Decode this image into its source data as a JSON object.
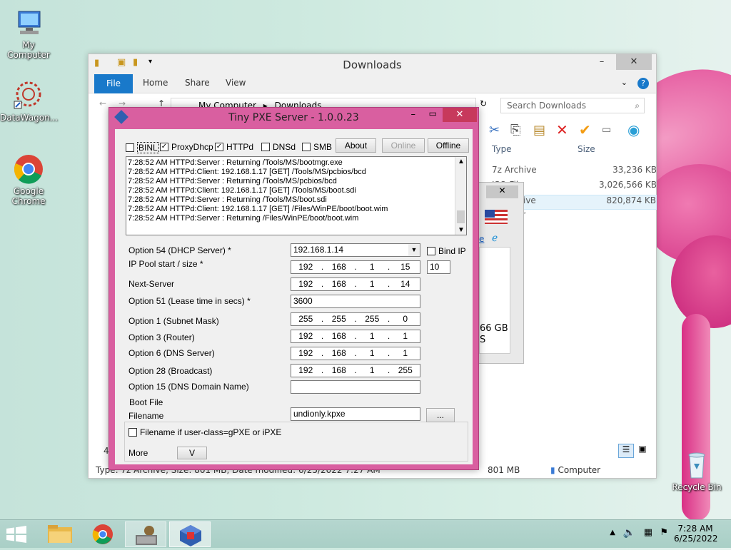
{
  "desktop": {
    "icons": [
      {
        "label": "My Computer"
      },
      {
        "label": "DataWagon..."
      },
      {
        "label": "Google Chrome"
      },
      {
        "label": "Recycle Bin"
      }
    ]
  },
  "explorer": {
    "title": "Downloads",
    "tabs": {
      "file": "File",
      "home": "Home",
      "share": "Share",
      "view": "View"
    },
    "breadcrumb": {
      "root": "My Computer",
      "sep": "▸",
      "current": "Downloads"
    },
    "search_placeholder": "Search Downloads",
    "columns": {
      "type": "Type",
      "size": "Size"
    },
    "rows": [
      {
        "type": "7z Archive",
        "size": "33,236 KB"
      },
      {
        "type": "ISO File",
        "size": "3,026,566 KB"
      },
      {
        "type": "ive",
        "size": "820,874 KB"
      }
    ],
    "side_text": "er",
    "status": {
      "left": "Type: 7z Archive, Size: 801 MB, Date modified: 6/25/2022 7:27 AM",
      "count": "4",
      "size": "801 MB",
      "location": "Computer"
    }
  },
  "bg_dialog": {
    "text1": "66 GB",
    "text2": "S",
    "link": "e"
  },
  "pxe": {
    "title": "Tiny PXE Server - 1.0.0.23",
    "checks": {
      "binl": {
        "label": "BINL",
        "checked": false
      },
      "proxydhcp": {
        "label": "ProxyDhcp",
        "checked": true
      },
      "httpd": {
        "label": "HTTPd",
        "checked": true
      },
      "dnsd": {
        "label": "DNSd",
        "checked": false
      },
      "smb": {
        "label": "SMB",
        "checked": false
      }
    },
    "buttons": {
      "about": "About",
      "online": "Online",
      "offline": "Offline",
      "browse": "...",
      "more": "V"
    },
    "log": [
      "7:28:52 AM HTTPd:Server : Returning /Tools/MS/bootmgr.exe",
      "7:28:52 AM HTTPd:Client: 192.168.1.17 [GET] /Tools/MS/pcbios/bcd",
      "7:28:52 AM HTTPd:Server : Returning /Tools/MS/pcbios/bcd",
      "7:28:52 AM HTTPd:Client: 192.168.1.17 [GET] /Tools/MS/boot.sdi",
      "7:28:52 AM HTTPd:Server : Returning /Tools/MS/boot.sdi",
      "7:28:52 AM HTTPd:Client: 192.168.1.17 [GET] /Files/WinPE/boot/boot.wim",
      "7:28:52 AM HTTPd:Server : Returning /Files/WinPE/boot/boot.wim"
    ],
    "labels": {
      "opt54": "Option 54 (DHCP Server) *",
      "pool": "IP Pool start / size *",
      "next": "Next-Server",
      "opt51": "Option 51 (Lease time in secs) *",
      "opt1": "Option 1  (Subnet Mask)",
      "opt3": "Option 3  (Router)",
      "opt6": "Option 6  (DNS Server)",
      "opt28": "Option 28 (Broadcast)",
      "opt15": "Option 15 (DNS Domain Name)",
      "bindip": "Bind IP",
      "bootfile": "Boot File",
      "filename": "Filename",
      "userclass": "Filename if user-class=gPXE or iPXE",
      "more": "More"
    },
    "values": {
      "opt54": "192.168.1.14",
      "pool_start": [
        "192",
        "168",
        "1",
        "15"
      ],
      "pool_size": "10",
      "next": [
        "192",
        "168",
        "1",
        "14"
      ],
      "opt51": "3600",
      "opt1": [
        "255",
        "255",
        "255",
        "0"
      ],
      "opt3": [
        "192",
        "168",
        "1",
        "1"
      ],
      "opt6": [
        "192",
        "168",
        "1",
        "1"
      ],
      "opt28": [
        "192",
        "168",
        "1",
        "255"
      ],
      "opt15": "",
      "filename": "undionly.kpxe"
    }
  },
  "taskbar": {
    "time": "7:28 AM",
    "date": "6/25/2022"
  }
}
